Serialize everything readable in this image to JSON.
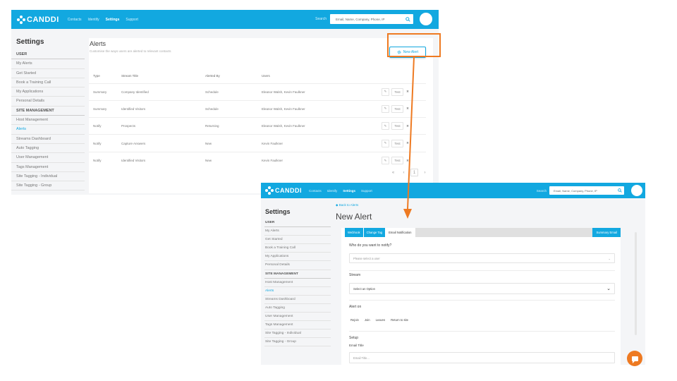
{
  "brand": {
    "name": "CANDDI",
    "accent": "#12a8e0",
    "highlight": "#ee7a22"
  },
  "top": {
    "nav": [
      "Contacts",
      "Identify",
      "Settings",
      "Support"
    ],
    "active_nav": "Settings",
    "search_label": "Search",
    "search_placeholder": "Email, Name, Company, Phone, IP"
  },
  "sidebar": {
    "title": "Settings",
    "user_head": "USER",
    "user_items": [
      "My Alerts",
      "Get Started",
      "Book a Training Call",
      "My Applications",
      "Personal Details"
    ],
    "site_head": "SITE MANAGEMENT",
    "site_items": [
      "Host Management",
      "Alerts",
      "Streams Dashboard",
      "Auto Tagging",
      "User Management",
      "Tags Management",
      "Site Tagging - Individual",
      "Site Tagging - Group"
    ],
    "active_item": "Alerts"
  },
  "alerts_page": {
    "title": "Alerts",
    "subtitle": "Customise the ways users are alerted to relevant contacts",
    "new_button": "New Alert",
    "columns": [
      "Type",
      "Stream Title",
      "Alerted By",
      "Users"
    ],
    "rows": [
      {
        "type": "Summary",
        "stream": "Company Identified",
        "by": "Schedule",
        "users": "Eleanor Walsh, Kevin Faulkner"
      },
      {
        "type": "Summary",
        "stream": "Identified Visitors",
        "by": "Schedule",
        "users": "Eleanor Walsh, Kevin Faulkner"
      },
      {
        "type": "Notify",
        "stream": "Prospects",
        "by": "Returning",
        "users": "Eleanor Walsh, Kevin Faulkner"
      },
      {
        "type": "Notify",
        "stream": "Capture Answers",
        "by": "New",
        "users": "Kevin Faulkner"
      },
      {
        "type": "Notify",
        "stream": "Identified Visitors",
        "by": "New",
        "users": "Kevin Faulkner"
      }
    ],
    "test_label": "Test",
    "pager": {
      "first": "«",
      "prev": "‹",
      "current": "1",
      "next": "›"
    }
  },
  "new_alert_page": {
    "back_link": "◆ Back to Alerts",
    "title": "New Alert",
    "tabs": [
      "Webhook",
      "Change Tag",
      "Email Notification"
    ],
    "selected_tab": "Email Notification",
    "right_tab": "Summary Email",
    "who_label": "Who do you want to notify?",
    "who_placeholder": "Please select a user",
    "stream_label": "Stream",
    "stream_placeholder": "Select an Option",
    "alert_on_label": "Alert on",
    "alert_on_options": [
      "Rejoin",
      "Join",
      "Leaves",
      "Return to site"
    ],
    "setup_label": "Setup",
    "email_title_label": "Email Title",
    "email_title_placeholder": "Email Title..."
  },
  "sidebar2_items": [
    "My Alerts",
    "Get Started",
    "Book a Training Call",
    "My Applications",
    "Personal Details"
  ],
  "sidebar2_site_items": [
    "Host Management",
    "Alerts",
    "Streams Dashboard",
    "Auto Tagging",
    "User Management",
    "Tags Management",
    "Site Tagging - Individual",
    "Site Tagging - Group"
  ]
}
